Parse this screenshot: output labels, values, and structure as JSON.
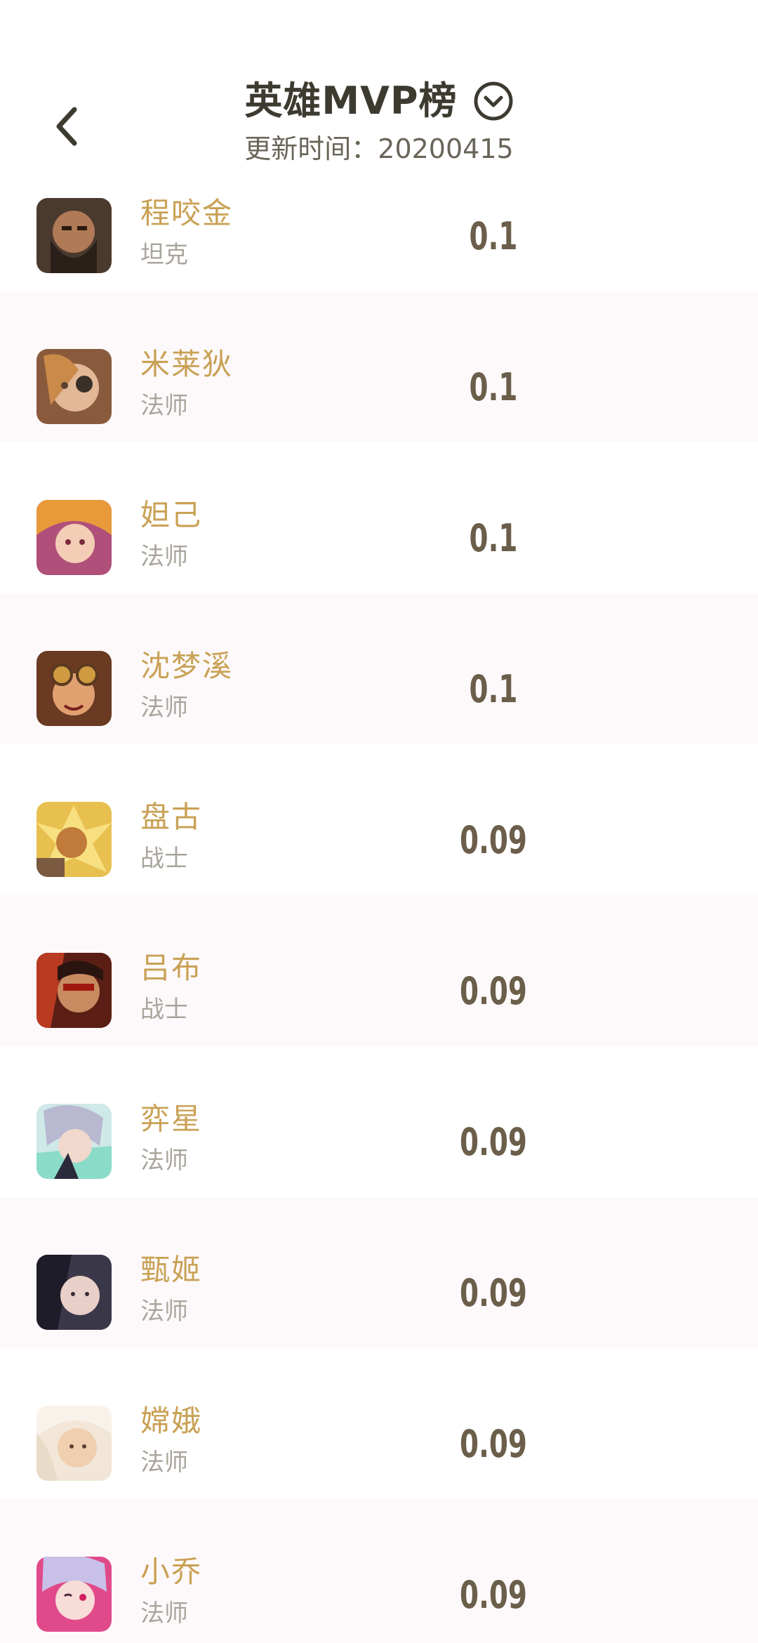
{
  "header": {
    "title": "英雄MVP榜",
    "update_time": "更新时间：20200415"
  },
  "colors": {
    "name": "#c9a155",
    "role": "#aaa59c",
    "score": "#6b5e4a",
    "title": "#3d3a30",
    "alt_row_bg": "#fdf9fb"
  },
  "heroes": [
    {
      "name": "程咬金",
      "role": "坦克",
      "score": "0.1",
      "avatar": "cheng-yaojin-avatar"
    },
    {
      "name": "米莱狄",
      "role": "法师",
      "score": "0.1",
      "avatar": "milady-avatar"
    },
    {
      "name": "妲己",
      "role": "法师",
      "score": "0.1",
      "avatar": "daji-avatar"
    },
    {
      "name": "沈梦溪",
      "role": "法师",
      "score": "0.1",
      "avatar": "shen-mengxi-avatar"
    },
    {
      "name": "盘古",
      "role": "战士",
      "score": "0.09",
      "avatar": "pangu-avatar"
    },
    {
      "name": "吕布",
      "role": "战士",
      "score": "0.09",
      "avatar": "lu-bu-avatar"
    },
    {
      "name": "弈星",
      "role": "法师",
      "score": "0.09",
      "avatar": "yixing-avatar"
    },
    {
      "name": "甄姬",
      "role": "法师",
      "score": "0.09",
      "avatar": "zhenji-avatar"
    },
    {
      "name": "嫦娥",
      "role": "法师",
      "score": "0.09",
      "avatar": "change-avatar"
    },
    {
      "name": "小乔",
      "role": "法师",
      "score": "0.09",
      "avatar": "xiaoqiao-avatar"
    }
  ]
}
